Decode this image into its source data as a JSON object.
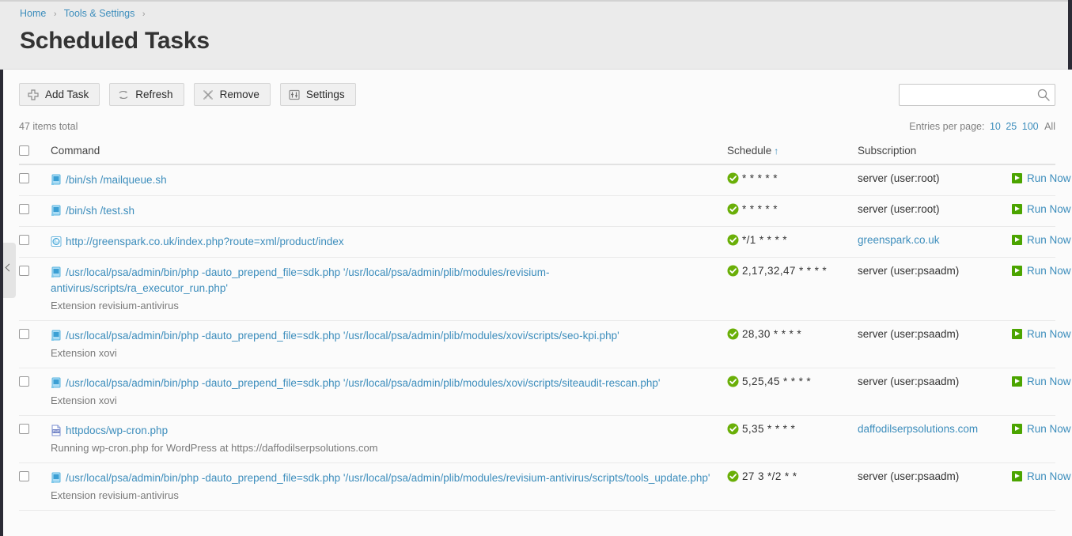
{
  "breadcrumb": {
    "items": [
      {
        "label": "Home",
        "link": true
      },
      {
        "label": "Tools & Settings",
        "link": true
      }
    ],
    "separator": "›"
  },
  "page": {
    "title": "Scheduled Tasks"
  },
  "toolbar": {
    "buttons": [
      {
        "label": "Add Task",
        "icon": "plus-icon"
      },
      {
        "label": "Refresh",
        "icon": "refresh-icon"
      },
      {
        "label": "Remove",
        "icon": "remove-cross-icon"
      },
      {
        "label": "Settings",
        "icon": "settings-sliders-icon"
      }
    ]
  },
  "search": {
    "value": "",
    "placeholder": "",
    "icon": "search-icon"
  },
  "list_info": {
    "items_total": "47 items total",
    "entries_label": "Entries per page:",
    "entries_options": [
      "10",
      "25",
      "100"
    ],
    "entries_all": "All"
  },
  "table": {
    "columns": [
      {
        "key": "command",
        "label": "Command",
        "sorted": false
      },
      {
        "key": "schedule",
        "label": "Schedule",
        "sorted": true,
        "sort_arrow": "↑"
      },
      {
        "key": "subscription",
        "label": "Subscription",
        "sorted": false
      }
    ],
    "action_label": "Run Now",
    "rows": [
      {
        "icon": "terminal-icon",
        "command": "/bin/sh /mailqueue.sh",
        "description": "",
        "schedule": "* * * * *",
        "schedule_status": "enabled",
        "subscription": "server (user:root)",
        "subscription_is_link": false,
        "action": "Run Now"
      },
      {
        "icon": "terminal-icon",
        "command": "/bin/sh /test.sh",
        "description": "",
        "schedule": "* * * * *",
        "schedule_status": "enabled",
        "subscription": "server (user:root)",
        "subscription_is_link": false,
        "action": "Run Now"
      },
      {
        "icon": "url-globe-icon",
        "command": "http://greenspark.co.uk/index.php?route=xml/product/index",
        "description": "",
        "schedule": "*/1 * * * *",
        "schedule_status": "enabled",
        "subscription": "greenspark.co.uk",
        "subscription_is_link": true,
        "action": "Run Now"
      },
      {
        "icon": "terminal-icon",
        "command": "/usr/local/psa/admin/bin/php -dauto_prepend_file=sdk.php '/usr/local/psa/admin/plib/modules/revisium-antivirus/scripts/ra_executor_run.php'",
        "description": "Extension revisium-antivirus",
        "schedule": "2,17,32,47 * * * *",
        "schedule_status": "enabled",
        "subscription": "server (user:psaadm)",
        "subscription_is_link": false,
        "action": "Run Now"
      },
      {
        "icon": "terminal-icon",
        "command": "/usr/local/psa/admin/bin/php -dauto_prepend_file=sdk.php '/usr/local/psa/admin/plib/modules/xovi/scripts/seo-kpi.php'",
        "description": "Extension xovi",
        "schedule": "28,30 * * * *",
        "schedule_status": "enabled",
        "subscription": "server (user:psaadm)",
        "subscription_is_link": false,
        "action": "Run Now"
      },
      {
        "icon": "terminal-icon",
        "command": "/usr/local/psa/admin/bin/php -dauto_prepend_file=sdk.php '/usr/local/psa/admin/plib/modules/xovi/scripts/siteaudit-rescan.php'",
        "description": "Extension xovi",
        "schedule": "5,25,45 * * * *",
        "schedule_status": "enabled",
        "subscription": "server (user:psaadm)",
        "subscription_is_link": false,
        "action": "Run Now"
      },
      {
        "icon": "php-file-icon",
        "command": "httpdocs/wp-cron.php",
        "description": "Running wp-cron.php for WordPress at https://daffodilserpsolutions.com",
        "schedule": "5,35 * * * *",
        "schedule_status": "enabled",
        "subscription": "daffodilserpsolutions.com",
        "subscription_is_link": true,
        "action": "Run Now"
      },
      {
        "icon": "terminal-icon",
        "command": "/usr/local/psa/admin/bin/php -dauto_prepend_file=sdk.php '/usr/local/psa/admin/plib/modules/revisium-antivirus/scripts/tools_update.php'",
        "description": "Extension revisium-antivirus",
        "schedule": "27 3 */2 * *",
        "schedule_status": "enabled",
        "subscription": "server (user:psaadm)",
        "subscription_is_link": false,
        "action": "Run Now"
      }
    ]
  },
  "sidebar": {
    "collapse_icon": "chevron-left-icon"
  },
  "colors": {
    "link": "#3c8dbc",
    "header_bg": "#ebebeb",
    "status_green": "#6aaf08",
    "run_green": "#4ba400",
    "text": "#333333",
    "muted": "#808080"
  }
}
